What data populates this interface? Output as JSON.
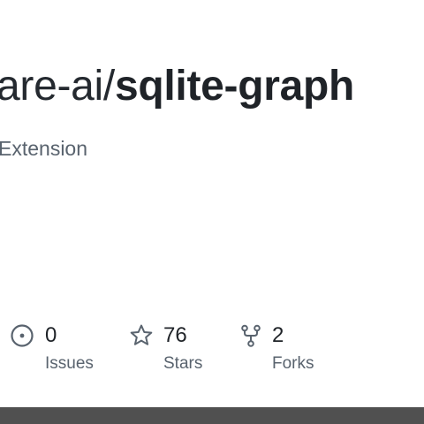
{
  "repo": {
    "owner": "are-ai/",
    "name": "sqlite-graph",
    "description": "Extension"
  },
  "stats": {
    "issues": {
      "count": "0",
      "label": "Issues",
      "icon": "issue-opened-icon"
    },
    "stars": {
      "count": "76",
      "label": "Stars",
      "icon": "star-icon"
    },
    "forks": {
      "count": "2",
      "label": "Forks",
      "icon": "repo-forked-icon"
    }
  },
  "colors": {
    "text_primary": "#1f2328",
    "text_muted": "#59636e",
    "bottom_bar": "#505050",
    "background": "#ffffff"
  }
}
